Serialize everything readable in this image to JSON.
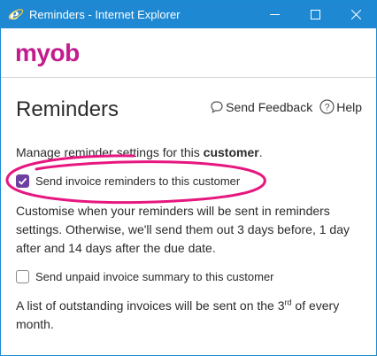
{
  "window": {
    "title": "Reminders - Internet Explorer"
  },
  "brand": {
    "logo_text": "myob",
    "logo_color": "#c21c8e"
  },
  "header": {
    "title": "Reminders",
    "send_feedback": "Send Feedback",
    "help": "Help"
  },
  "intro": {
    "prefix": "Manage reminder settings for this ",
    "bold": "customer",
    "suffix": "."
  },
  "option_invoice": {
    "label": "Send invoice reminders to this customer",
    "checked": true,
    "description": "Customise when your reminders will be sent in reminders settings. Otherwise, we'll send them out 3 days before, 1 day after and 14 days after the due date."
  },
  "option_summary": {
    "label": "Send unpaid invoice summary to this customer",
    "checked": false,
    "description_prefix": "A list of outstanding invoices will be sent on the 3",
    "description_sup": "rd",
    "description_suffix": " of every month."
  },
  "colors": {
    "titlebar": "#1e88d2",
    "checkbox_checked": "#6c3fa0",
    "annotation": "#e6177f"
  }
}
